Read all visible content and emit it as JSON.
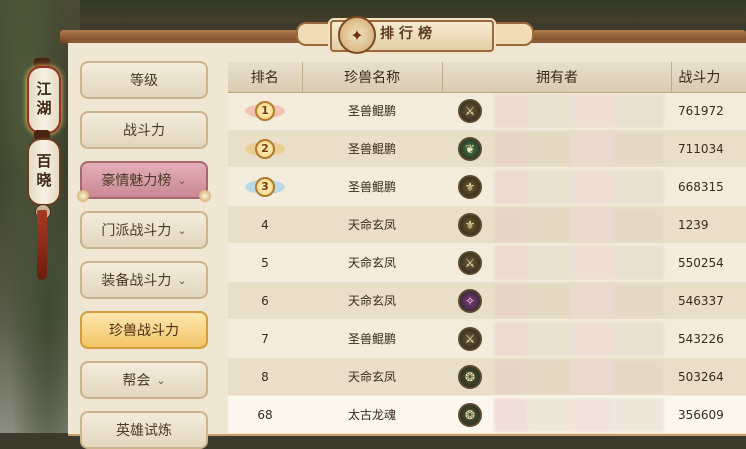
{
  "title": "排行榜",
  "side_scrolls": [
    "江湖",
    "百晓"
  ],
  "tabs": [
    {
      "label": "等级",
      "chevron": false,
      "state": "normal"
    },
    {
      "label": "战斗力",
      "chevron": false,
      "state": "normal"
    },
    {
      "label": "豪情魅力榜",
      "chevron": true,
      "state": "pink"
    },
    {
      "label": "门派战斗力",
      "chevron": true,
      "state": "normal"
    },
    {
      "label": "装备战斗力",
      "chevron": true,
      "state": "normal"
    },
    {
      "label": "珍兽战斗力",
      "chevron": false,
      "state": "active"
    },
    {
      "label": "帮会",
      "chevron": true,
      "state": "normal"
    },
    {
      "label": "英雄试炼",
      "chevron": false,
      "state": "normal"
    }
  ],
  "table": {
    "headers": [
      "排名",
      "珍兽名称",
      "拥有者",
      "战斗力"
    ],
    "rows": [
      {
        "rank": "1",
        "medal": "gold-orange",
        "name": "圣兽鲲鹏",
        "icon": "dagger-icon",
        "icon_color": "#6b5a3a",
        "power": "761972"
      },
      {
        "rank": "2",
        "medal": "gold",
        "name": "圣兽鲲鹏",
        "icon": "leaf-icon",
        "icon_color": "#3a7a4a",
        "power": "711034"
      },
      {
        "rank": "3",
        "medal": "gold-blue",
        "name": "圣兽鲲鹏",
        "icon": "lotus-icon",
        "icon_color": "#6a5a2a",
        "power": "668315"
      },
      {
        "rank": "4",
        "medal": "",
        "name": "天命玄凤",
        "icon": "lotus-icon",
        "icon_color": "#6a5a2a",
        "power": "1239"
      },
      {
        "rank": "5",
        "medal": "",
        "name": "天命玄凤",
        "icon": "dagger-icon",
        "icon_color": "#6b5a3a",
        "power": "550254"
      },
      {
        "rank": "6",
        "medal": "",
        "name": "天命玄凤",
        "icon": "claw-icon",
        "icon_color": "#7a3a8a",
        "power": "546337"
      },
      {
        "rank": "7",
        "medal": "",
        "name": "圣兽鲲鹏",
        "icon": "dagger-icon",
        "icon_color": "#6b5a3a",
        "power": "543226"
      },
      {
        "rank": "8",
        "medal": "",
        "name": "天命玄凤",
        "icon": "dragon-icon",
        "icon_color": "#4a5a3a",
        "power": "503264"
      },
      {
        "rank": "68",
        "medal": "",
        "name": "太古龙魂",
        "icon": "dragon-icon",
        "icon_color": "#4a5a3a",
        "power": "356609"
      }
    ]
  }
}
